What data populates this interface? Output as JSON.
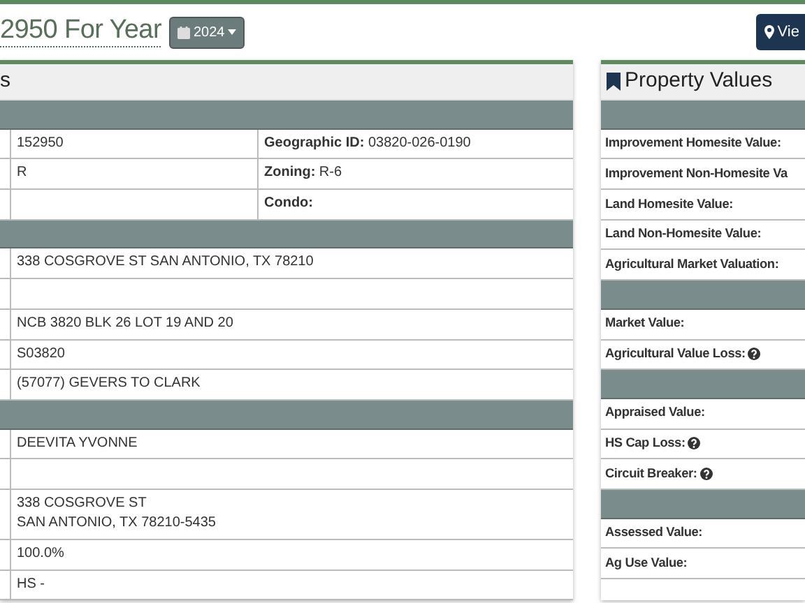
{
  "title": "2950 For Year",
  "year_button": {
    "label": "2024"
  },
  "map_button": {
    "label": "Vie"
  },
  "details_panel": {
    "header": "s",
    "rows": [
      {
        "kind": "band"
      },
      {
        "kind": "pair",
        "cells": [
          {
            "text": "152950"
          },
          {
            "label": "Geographic ID:",
            "text": "03820-026-0190"
          }
        ]
      },
      {
        "kind": "pair",
        "cells": [
          {
            "text": "R"
          },
          {
            "label": "Zoning:",
            "text": "R-6"
          }
        ]
      },
      {
        "kind": "pair",
        "cells": [
          {},
          {
            "label": "Condo:"
          }
        ]
      },
      {
        "kind": "band"
      },
      {
        "kind": "wide",
        "lines": [
          "338 COSGROVE ST SAN ANTONIO, TX 78210"
        ]
      },
      {
        "kind": "wide",
        "lines": []
      },
      {
        "kind": "wide",
        "lines": [
          "NCB 3820 BLK 26 LOT 19 AND 20"
        ]
      },
      {
        "kind": "wide",
        "lines": [
          "S03820"
        ]
      },
      {
        "kind": "wide",
        "lines": [
          "(57077) GEVERS TO CLARK"
        ]
      },
      {
        "kind": "band"
      },
      {
        "kind": "wide",
        "lines": [
          "DEEVITA YVONNE"
        ]
      },
      {
        "kind": "wide",
        "lines": []
      },
      {
        "kind": "wide",
        "lines": [
          "338 COSGROVE ST",
          "SAN ANTONIO, TX 78210-5435"
        ]
      },
      {
        "kind": "wide",
        "lines": [
          "100.0%"
        ]
      },
      {
        "kind": "wide",
        "lines": [
          "HS -"
        ]
      }
    ]
  },
  "values_panel": {
    "header": "Property Values",
    "rows": [
      {
        "kind": "band"
      },
      {
        "kind": "row",
        "label": "Improvement Homesite Value:",
        "help": false
      },
      {
        "kind": "row",
        "label": "Improvement Non-Homesite Va",
        "help": false
      },
      {
        "kind": "row",
        "label": "Land Homesite Value:",
        "help": false
      },
      {
        "kind": "row",
        "label": "Land Non-Homesite Value:",
        "help": false
      },
      {
        "kind": "row",
        "label": "Agricultural Market Valuation:",
        "help": false
      },
      {
        "kind": "band"
      },
      {
        "kind": "row",
        "label": "Market Value:",
        "help": false
      },
      {
        "kind": "row",
        "label": "Agricultural Value Loss:",
        "help": true
      },
      {
        "kind": "band"
      },
      {
        "kind": "row",
        "label": "Appraised Value:",
        "help": false
      },
      {
        "kind": "row",
        "label": "HS Cap Loss:",
        "help": true
      },
      {
        "kind": "row",
        "label": "Circuit Breaker:",
        "help": true
      },
      {
        "kind": "band"
      },
      {
        "kind": "row",
        "label": "Assessed Value:",
        "help": false
      },
      {
        "kind": "row",
        "label": "Ag Use Value:",
        "help": false
      }
    ]
  }
}
